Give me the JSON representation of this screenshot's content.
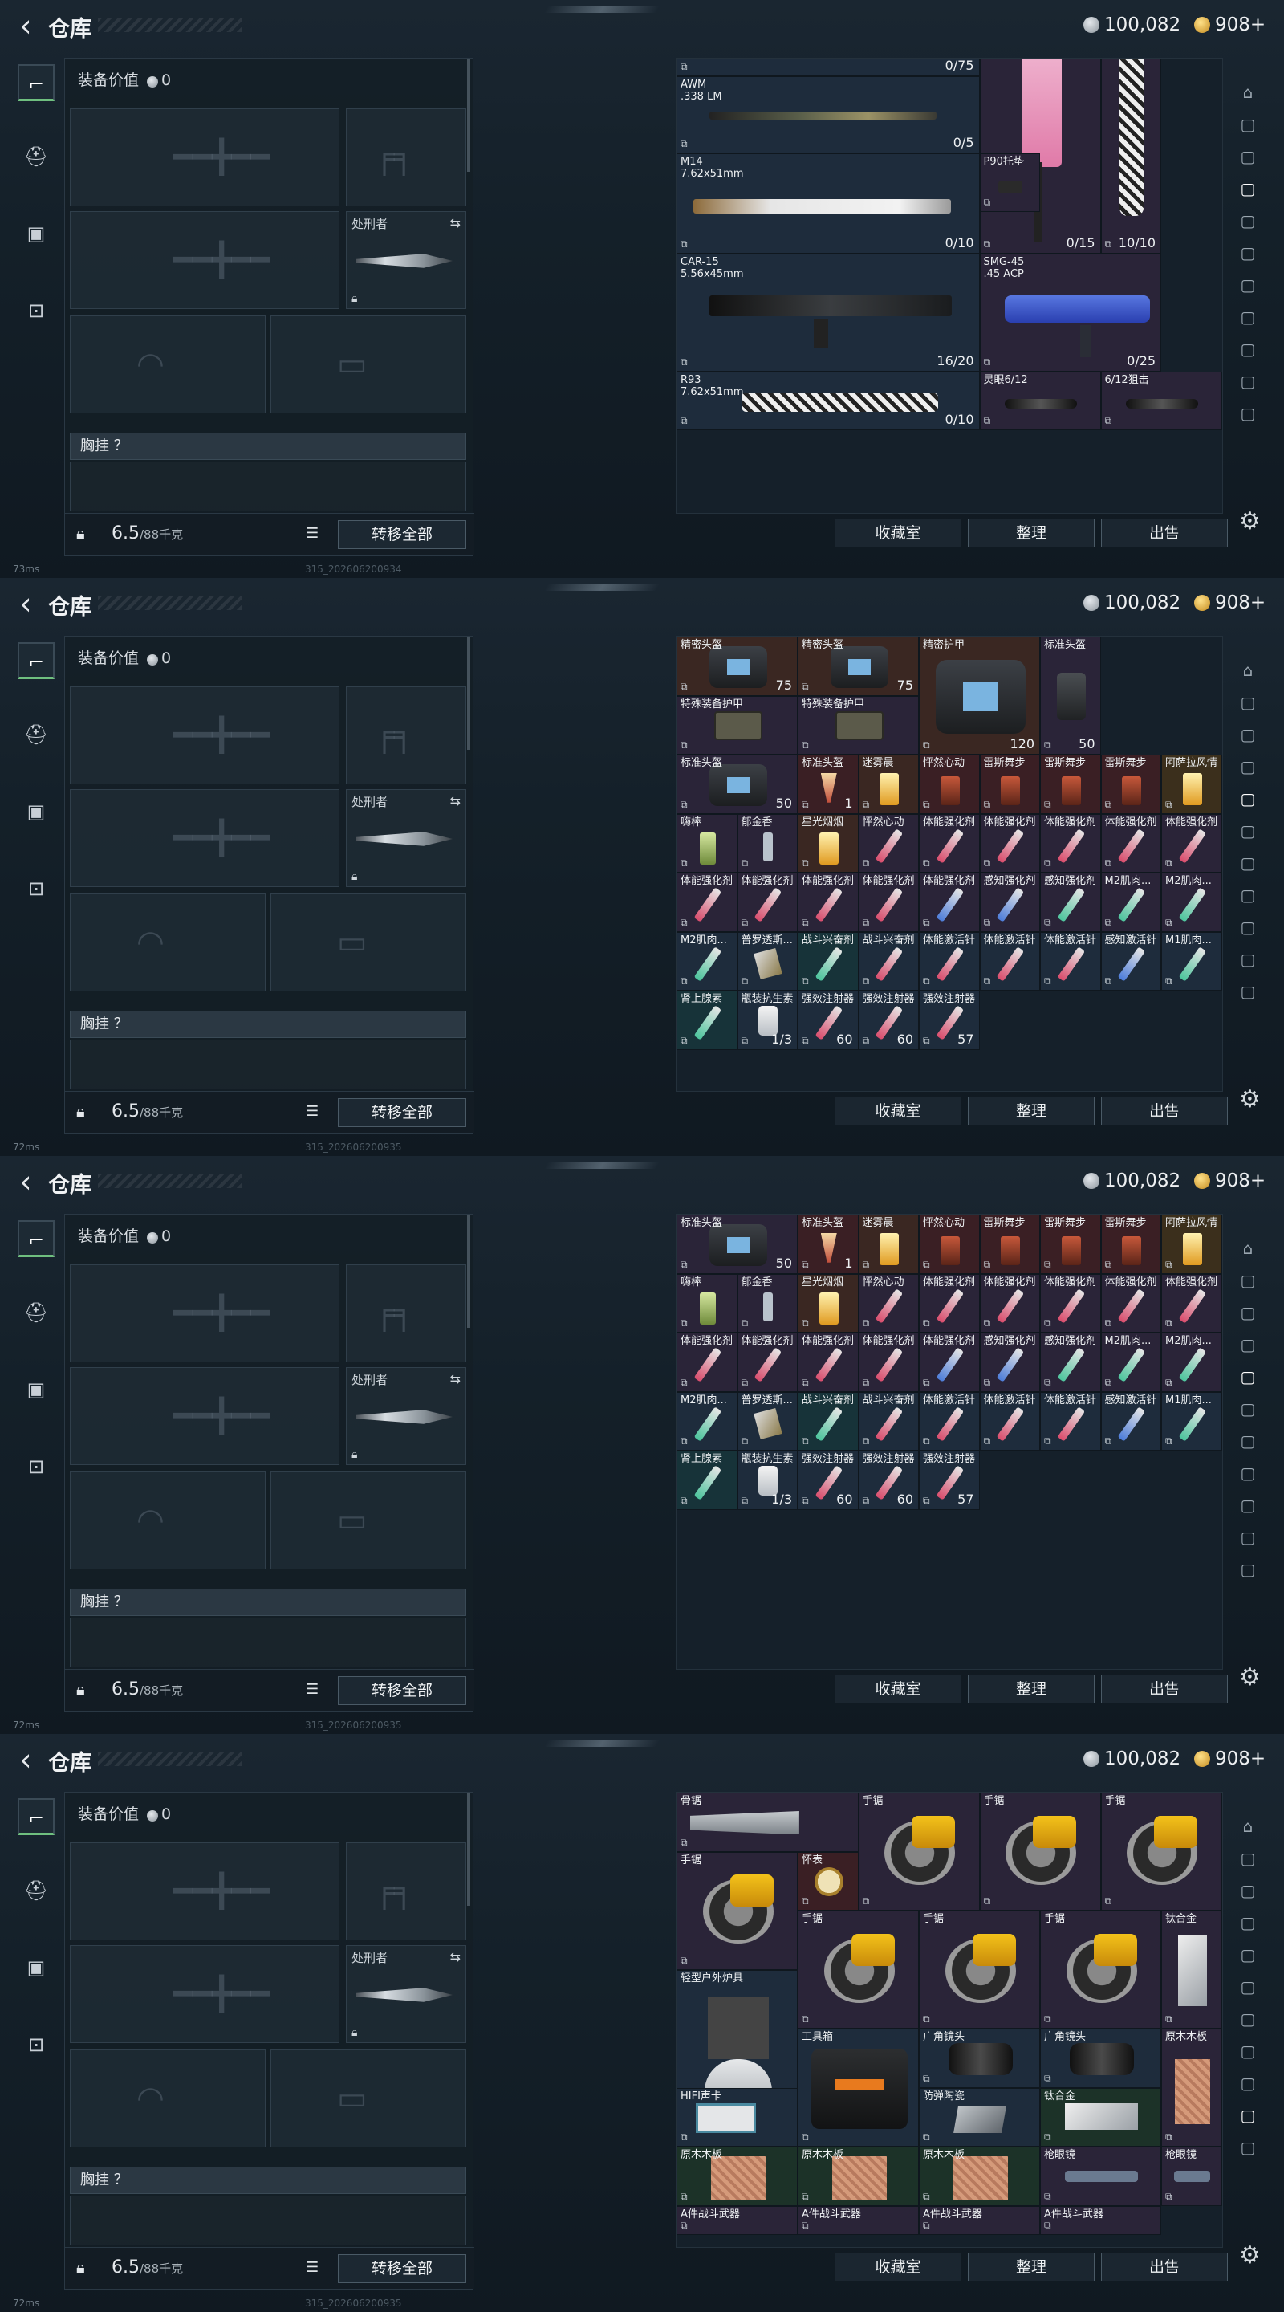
{
  "app": {
    "title": "仓库",
    "silver": "100,082",
    "gold": "908+"
  },
  "loadout": {
    "value_label": "装备价值",
    "value": "0",
    "executioner_label": "处刑者",
    "chest_label": "胸挂 ？",
    "weight": "6.5",
    "weight_cap": "/88千克",
    "transfer_all": "转移全部"
  },
  "actions": {
    "collection": "收藏室",
    "sort": "整理",
    "sell": "出售"
  },
  "status": {
    "ping1": "73ms",
    "ping2": "72ms",
    "ping3": "72ms",
    "ping4": "72ms",
    "build1": "315_202606200934",
    "build2": "315_202606200935",
    "build3": "315_202606200935",
    "build4": "315_202606200935"
  },
  "panel1": {
    "cells": [
      {
        "name": "",
        "count": "0/75"
      },
      {
        "name": "AWM\n.338 LM",
        "count": "0/5"
      },
      {
        "name": "",
        "count": "0/15"
      },
      {
        "name": "",
        "count": "10/10"
      },
      {
        "name": "M14\n7.62x51mm",
        "count": "0/10"
      },
      {
        "name": "P90托垫",
        "count": ""
      },
      {
        "name": "CAR-15\n5.56x45mm",
        "count": "16/20"
      },
      {
        "name": "SMG-45\n.45 ACP",
        "count": "0/25"
      },
      {
        "name": "R93\n7.62x51mm",
        "count": "0/10"
      },
      {
        "name": "灵眼6/12",
        "count": ""
      },
      {
        "name": "6/12狙击",
        "count": ""
      }
    ]
  },
  "panel2": {
    "cells": [
      {
        "name": "精密头盔",
        "count": "75"
      },
      {
        "name": "精密头盔",
        "count": "75"
      },
      {
        "name": "精密护甲",
        "count": "120"
      },
      {
        "name": "标准头盔",
        "count": "50"
      },
      {
        "name": "特殊装备护甲",
        "count": ""
      },
      {
        "name": "特殊装备护甲",
        "count": ""
      },
      {
        "name": "标准头盔",
        "count": "50"
      },
      {
        "name": "标准头盔",
        "count": "1"
      },
      {
        "name": "迷雾晨",
        "count": ""
      },
      {
        "name": "怦然心动",
        "count": ""
      },
      {
        "name": "雷斯舞步",
        "count": ""
      },
      {
        "name": "雷斯舞步",
        "count": ""
      },
      {
        "name": "雷斯舞步",
        "count": ""
      },
      {
        "name": "阿萨拉风情",
        "count": ""
      },
      {
        "name": "嗨棒",
        "count": ""
      },
      {
        "name": "郁金香",
        "count": ""
      },
      {
        "name": "星光烟烟",
        "count": ""
      },
      {
        "name": "怦然心动",
        "count": ""
      },
      {
        "name": "体能强化剂",
        "count": ""
      },
      {
        "name": "体能强化剂",
        "count": ""
      },
      {
        "name": "体能强化剂",
        "count": ""
      },
      {
        "name": "体能强化剂",
        "count": ""
      },
      {
        "name": "体能强化剂",
        "count": ""
      },
      {
        "name": "体能强化剂",
        "count": ""
      },
      {
        "name": "体能强化剂",
        "count": ""
      },
      {
        "name": "体能强化剂",
        "count": ""
      },
      {
        "name": "体能强化剂",
        "count": ""
      },
      {
        "name": "体能强化剂",
        "count": ""
      },
      {
        "name": "感知强化剂",
        "count": ""
      },
      {
        "name": "感知强化剂",
        "count": ""
      },
      {
        "name": "M2肌肉...",
        "count": ""
      },
      {
        "name": "M2肌肉...",
        "count": ""
      },
      {
        "name": "M2肌肉...",
        "count": ""
      },
      {
        "name": "普罗透斯...",
        "count": ""
      },
      {
        "name": "战斗兴奋剂",
        "count": ""
      },
      {
        "name": "战斗兴奋剂",
        "count": ""
      },
      {
        "name": "体能激活针",
        "count": ""
      },
      {
        "name": "体能激活针",
        "count": ""
      },
      {
        "name": "体能激活针",
        "count": ""
      },
      {
        "name": "感知激活针",
        "count": ""
      },
      {
        "name": "M1肌肉...",
        "count": ""
      },
      {
        "name": "肾上腺素",
        "count": ""
      },
      {
        "name": "瓶装抗生素",
        "count": "1/3"
      },
      {
        "name": "强效注射器",
        "count": "60"
      },
      {
        "name": "强效注射器",
        "count": "60"
      },
      {
        "name": "强效注射器",
        "count": "57"
      }
    ]
  },
  "panel4": {
    "cells": [
      {
        "name": "骨锯",
        "count": ""
      },
      {
        "name": "手锯",
        "count": ""
      },
      {
        "name": "手锯",
        "count": ""
      },
      {
        "name": "手锯",
        "count": ""
      },
      {
        "name": "手锯",
        "count": ""
      },
      {
        "name": "怀表",
        "count": ""
      },
      {
        "name": "手锯",
        "count": ""
      },
      {
        "name": "手锯",
        "count": ""
      },
      {
        "name": "手锯",
        "count": ""
      },
      {
        "name": "钛合金",
        "count": ""
      },
      {
        "name": "轻型户外炉具",
        "count": ""
      },
      {
        "name": "工具箱",
        "count": ""
      },
      {
        "name": "广角镜头",
        "count": ""
      },
      {
        "name": "广角镜头",
        "count": ""
      },
      {
        "name": "原木木板",
        "count": ""
      },
      {
        "name": "HIFI声卡",
        "count": ""
      },
      {
        "name": "防弹陶瓷",
        "count": ""
      },
      {
        "name": "钛合金",
        "count": ""
      },
      {
        "name": "原木木板",
        "count": ""
      },
      {
        "name": "原木木板",
        "count": ""
      },
      {
        "name": "原木木板",
        "count": ""
      },
      {
        "name": "枪眼镜",
        "count": ""
      },
      {
        "name": "枪眼镜",
        "count": ""
      },
      {
        "name": "A件战斗武器",
        "count": ""
      },
      {
        "name": "A件战斗武器",
        "count": ""
      },
      {
        "name": "A件战斗武器",
        "count": ""
      },
      {
        "name": "A件战斗武器",
        "count": ""
      }
    ]
  },
  "colors": {
    "accent_green": "#6fbf7f",
    "rarity_orange": "#3a2722",
    "rarity_red": "#3a1f24",
    "rarity_purple": "#2a2438",
    "rarity_blue": "#1e2c3c",
    "rarity_teal": "#173339"
  }
}
